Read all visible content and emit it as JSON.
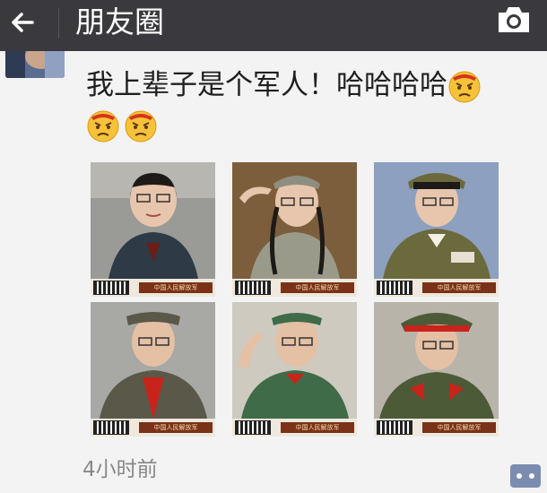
{
  "header": {
    "title": "朋友圈",
    "back_icon": "arrow-left-icon",
    "camera_icon": "camera-icon"
  },
  "post": {
    "text": "我上辈子是个军人！哈哈哈哈",
    "emojis": [
      "angry-face-emoji",
      "angry-face-emoji",
      "angry-face-emoji"
    ],
    "photo_caption": "中国人民解放军",
    "timestamp": "4小时前",
    "comment_icon": "comment-dots-icon"
  },
  "photos": [
    {
      "caption": "中国人民解放军"
    },
    {
      "caption": "中国人民解放军"
    },
    {
      "caption": "中国人民解放军"
    },
    {
      "caption": "中国人民解放军"
    },
    {
      "caption": "中国人民解放军"
    },
    {
      "caption": "中国人民解放军"
    }
  ]
}
